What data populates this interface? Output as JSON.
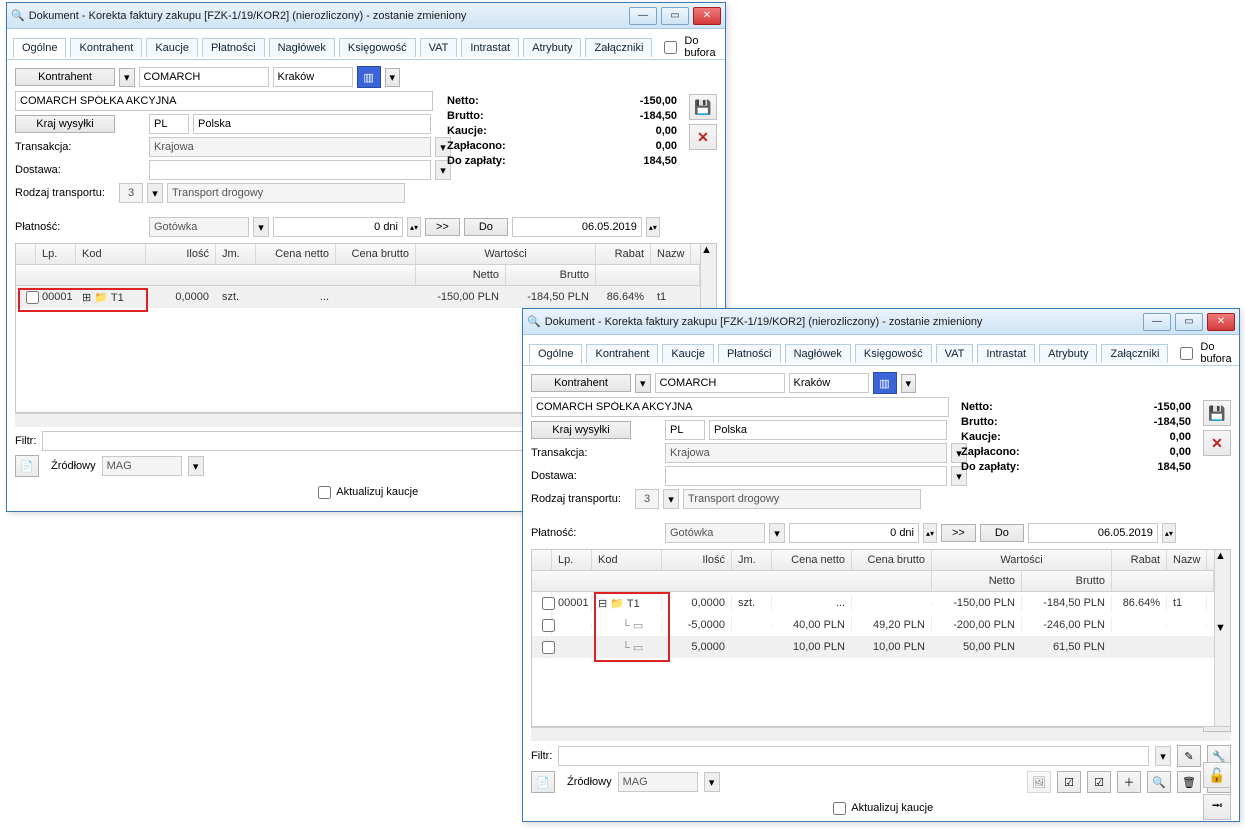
{
  "common": {
    "title": "Dokument - Korekta faktury zakupu [FZK-1/19/KOR2] (nierozliczony) - zostanie zmieniony",
    "tabs": [
      "Ogólne",
      "Kontrahent",
      "Kaucje",
      "Płatności",
      "Nagłówek",
      "Księgowość",
      "VAT",
      "Intrastat",
      "Atrybuty",
      "Załączniki"
    ],
    "bufor_label": "Do bufora",
    "kontrahent_btn": "Kontrahent",
    "kontrahent_code": "COMARCH",
    "kontrahent_city": "Kraków",
    "kontrahent_name": "COMARCH SPÓŁKA AKCYJNA",
    "kraj_btn": "Kraj wysyłki",
    "kraj_code": "PL",
    "kraj_name": "Polska",
    "transakcja_label": "Transakcja:",
    "transakcja_val": "Krajowa",
    "dostawa_label": "Dostawa:",
    "dostawa_val": "",
    "rodzaj_label": "Rodzaj transportu:",
    "rodzaj_code": "3",
    "rodzaj_name": "Transport drogowy",
    "platnosc_label": "Płatność:",
    "platnosc_val": "Gotówka",
    "platnosc_dni": "0 dni",
    "arrow_btn": ">>",
    "do_btn": "Do",
    "data_do": "06.05.2019",
    "sum_netto_l": "Netto:",
    "sum_netto_v": "-150,00",
    "sum_brutto_l": "Brutto:",
    "sum_brutto_v": "-184,50",
    "sum_kaucje_l": "Kaucje:",
    "sum_kaucje_v": "0,00",
    "sum_zapl_l": "Zapłacono:",
    "sum_zapl_v": "0,00",
    "sum_dozapl_l": "Do zapłaty:",
    "sum_dozapl_v": "184,50",
    "cols": {
      "lp": "Lp.",
      "kod": "Kod",
      "ilosc": "Ilość",
      "jm": "Jm.",
      "cn": "Cena netto",
      "cb": "Cena brutto",
      "wart": "Wartości",
      "wn": "Netto",
      "wb": "Brutto",
      "rabat": "Rabat",
      "nazwa": "Nazw"
    },
    "filtr_label": "Filtr:",
    "zrodlowy_label": "Źródłowy",
    "mag_val": "MAG",
    "aktualizuj_label": "Aktualizuj kaucje"
  },
  "w1": {
    "rows": [
      {
        "lp": "00001",
        "kod": "T1",
        "ilosc": "0,0000",
        "jm": "szt.",
        "cn": "...",
        "cb": "",
        "wn": "-150,00 PLN",
        "wb": "-184,50 PLN",
        "rabat": "86.64%",
        "nazwa": "t1"
      }
    ]
  },
  "w2": {
    "rows": [
      {
        "lp": "00001",
        "kod": "T1",
        "ilosc": "0,0000",
        "jm": "szt.",
        "cn": "...",
        "cb": "",
        "wn": "-150,00 PLN",
        "wb": "-184,50 PLN",
        "rabat": "86.64%",
        "nazwa": "t1"
      },
      {
        "lp": "",
        "kod": "",
        "ilosc": "-5,0000",
        "jm": "",
        "cn": "40,00 PLN",
        "cb": "49,20 PLN",
        "wn": "-200,00 PLN",
        "wb": "-246,00 PLN",
        "rabat": "",
        "nazwa": ""
      },
      {
        "lp": "",
        "kod": "",
        "ilosc": "5,0000",
        "jm": "",
        "cn": "10,00 PLN",
        "cb": "10,00 PLN",
        "wn": "50,00 PLN",
        "wb": "61,50 PLN",
        "rabat": "",
        "nazwa": ""
      }
    ]
  }
}
